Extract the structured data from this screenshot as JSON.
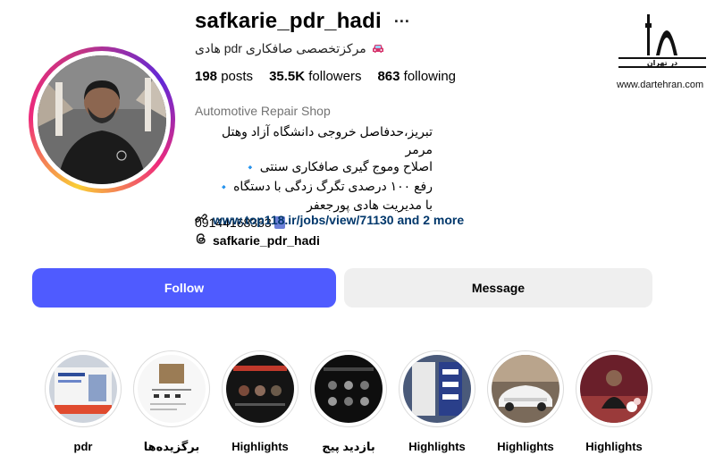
{
  "profile": {
    "username": "safkarie_pdr_hadi",
    "more_label": "···",
    "full_name": "مرکزتخصصی صافکاری pdr هادی",
    "stats": {
      "posts_count": "198",
      "posts_label": "posts",
      "followers_count": "35.5K",
      "followers_label": "followers",
      "following_count": "863",
      "following_label": "following"
    },
    "category": "Automotive Repair Shop",
    "bio_lines": [
      "تبریز،حدفاصل خروجی دانشگاه آزاد وهتل مرمر",
      "اصلاح وموج گیری صافکاری سنتی",
      "رفع ۱۰۰ درصدی تگرگ زدگی با دستگاه",
      "با مدیریت هادی پورجعفر",
      "09144168363"
    ],
    "bio_bullet": "🔹",
    "link_text": "www.top118.ir/jobs/view/71130 and 2 more",
    "threads_handle": "safkarie_pdr_hadi"
  },
  "actions": {
    "follow_label": "Follow",
    "message_label": "Message"
  },
  "highlights": [
    {
      "label": "pdr"
    },
    {
      "label": "برگزیده‌ها"
    },
    {
      "label": "Highlights"
    },
    {
      "label": "بازدید پیج"
    },
    {
      "label": "Highlights"
    },
    {
      "label": "Highlights"
    },
    {
      "label": "Highlights"
    }
  ],
  "watermark": {
    "logo_text": "در تهران",
    "url": "www.dartehran.com"
  },
  "colors": {
    "follow_button": "#4f5bff",
    "message_button": "#efefef",
    "link": "#00376b",
    "category": "#737373"
  },
  "icons": {
    "more": "more-icon",
    "car": "car-icon",
    "link": "link-icon",
    "threads": "threads-icon",
    "phone": "phone-icon"
  }
}
